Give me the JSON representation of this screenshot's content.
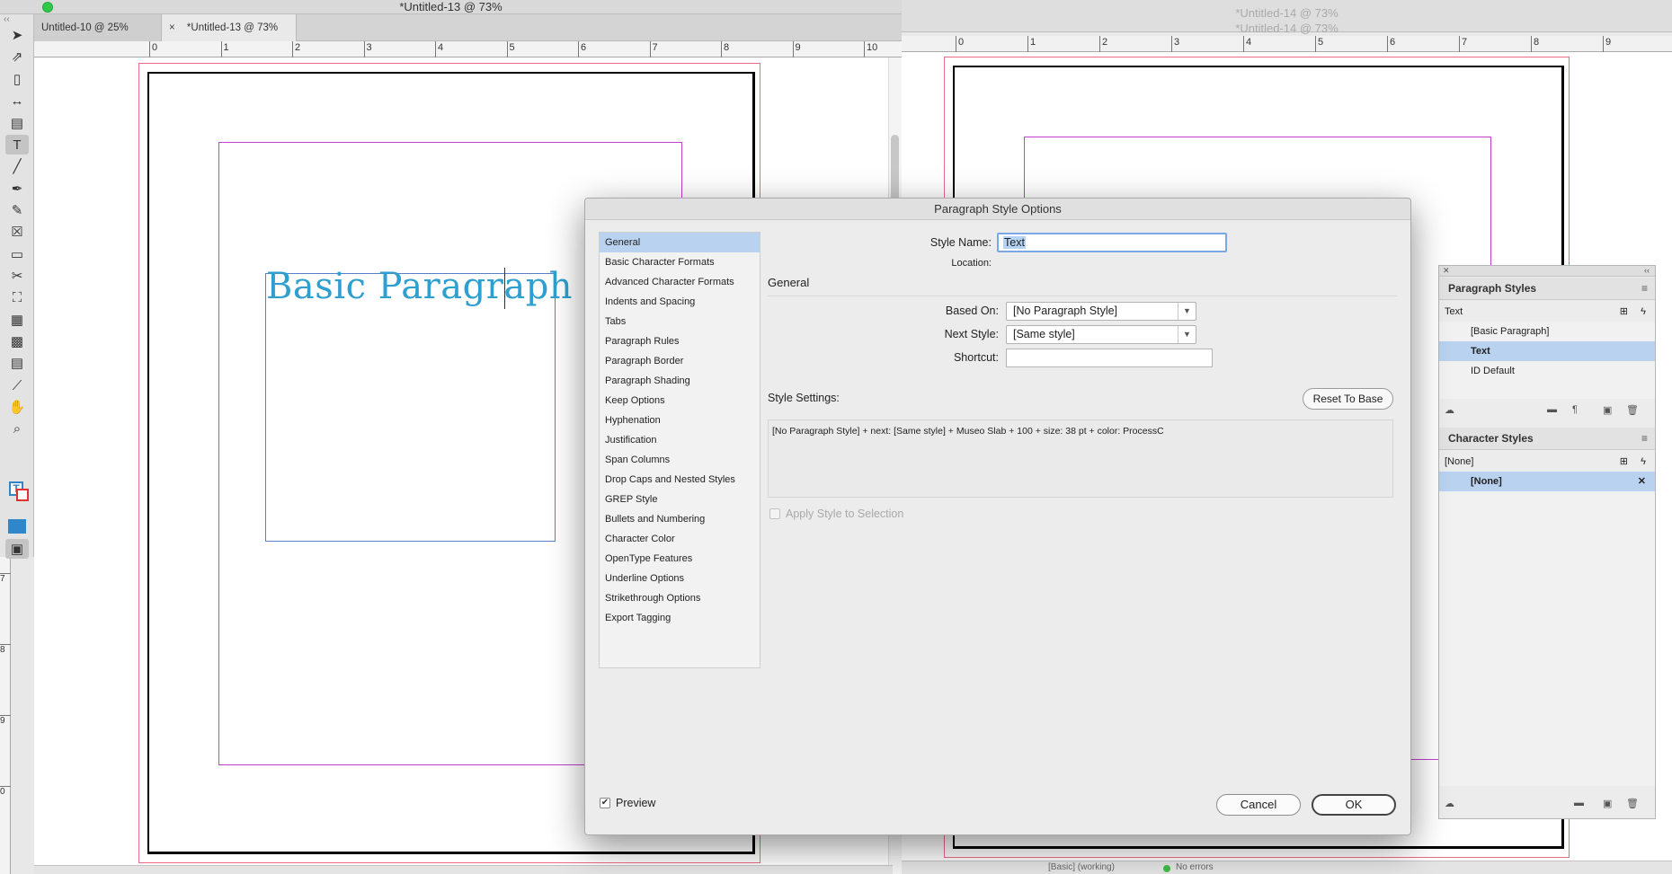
{
  "left_window": {
    "title": "*Untitled-13 @ 73%",
    "tabs": [
      {
        "label": "Untitled-10 @ 25%"
      },
      {
        "label": "*Untitled-13 @ 73%",
        "close": "×"
      }
    ],
    "ruler_h": [
      "0",
      "1",
      "2",
      "3",
      "4",
      "5",
      "6",
      "7",
      "8",
      "9",
      "10"
    ],
    "ruler_v": [
      "7",
      "8",
      "9",
      "0"
    ],
    "frame_text": "Basic Paragraph"
  },
  "right_window": {
    "title_a": "*Untitled-14 @ 73%",
    "title_b": "*Untitled-14 @ 73%",
    "ruler_h": [
      "0",
      "1",
      "2",
      "3",
      "4",
      "5",
      "6",
      "7",
      "8",
      "9"
    ],
    "status": {
      "basic": "[Basic] (working)",
      "errors": "No errors"
    }
  },
  "toolbar": {
    "tools": [
      {
        "name": "selection-tool-icon",
        "glyph": "➤"
      },
      {
        "name": "direct-selection-tool-icon",
        "glyph": "⇗"
      },
      {
        "name": "page-tool-icon",
        "glyph": "▯"
      },
      {
        "name": "gap-tool-icon",
        "glyph": "↔"
      },
      {
        "name": "content-collector-icon",
        "glyph": "▤"
      },
      {
        "name": "type-tool-icon",
        "glyph": "T"
      },
      {
        "name": "line-tool-icon",
        "glyph": "╱"
      },
      {
        "name": "pen-tool-icon",
        "glyph": "✒"
      },
      {
        "name": "pencil-tool-icon",
        "glyph": "✎"
      },
      {
        "name": "rectangle-frame-tool-icon",
        "glyph": "☒"
      },
      {
        "name": "rectangle-tool-icon",
        "glyph": "▭"
      },
      {
        "name": "scissors-tool-icon",
        "glyph": "✂"
      },
      {
        "name": "free-transform-tool-icon",
        "glyph": "⛶"
      },
      {
        "name": "gradient-swatch-tool-icon",
        "glyph": "▦"
      },
      {
        "name": "gradient-feather-tool-icon",
        "glyph": "▩"
      },
      {
        "name": "note-tool-icon",
        "glyph": "▤"
      },
      {
        "name": "eyedropper-tool-icon",
        "glyph": "⟋"
      },
      {
        "name": "hand-tool-icon",
        "glyph": "✋"
      },
      {
        "name": "zoom-tool-icon",
        "glyph": "⌕"
      }
    ]
  },
  "dialog": {
    "title": "Paragraph Style Options",
    "categories": [
      "General",
      "Basic Character Formats",
      "Advanced Character Formats",
      "Indents and Spacing",
      "Tabs",
      "Paragraph Rules",
      "Paragraph Border",
      "Paragraph Shading",
      "Keep Options",
      "Hyphenation",
      "Justification",
      "Span Columns",
      "Drop Caps and Nested Styles",
      "GREP Style",
      "Bullets and Numbering",
      "Character Color",
      "OpenType Features",
      "Underline Options",
      "Strikethrough Options",
      "Export Tagging"
    ],
    "selected_category": "General",
    "style_name_label": "Style Name:",
    "style_name_value": "Text",
    "location_label": "Location:",
    "section_title": "General",
    "based_on_label": "Based On:",
    "based_on_value": "[No Paragraph Style]",
    "next_style_label": "Next Style:",
    "next_style_value": "[Same style]",
    "shortcut_label": "Shortcut:",
    "shortcut_value": "",
    "style_settings_label": "Style Settings:",
    "reset_button": "Reset To Base",
    "style_settings_text": "[No Paragraph Style] + next: [Same style] + Museo Slab + 100 + size: 38 pt + color: ProcessC",
    "apply_label": "Apply Style to Selection",
    "apply_checked": false,
    "preview_label": "Preview",
    "preview_checked": true,
    "cancel_button": "Cancel",
    "ok_button": "OK"
  },
  "paragraph_styles_panel": {
    "title": "Paragraph Styles",
    "current": "Text",
    "items": [
      {
        "label": "[Basic Paragraph]",
        "selected": false
      },
      {
        "label": "Text",
        "selected": true
      },
      {
        "label": "ID Default",
        "selected": false
      }
    ]
  },
  "character_styles_panel": {
    "title": "Character Styles",
    "current": "[None]",
    "items": [
      {
        "label": "[None]",
        "selected": true
      }
    ]
  },
  "colors": {
    "accent_blue": "#2f9fd0",
    "selection": "#b8d2ef",
    "margin_guide": "#c23fcf",
    "bleed_guide": "#ee6b86"
  }
}
